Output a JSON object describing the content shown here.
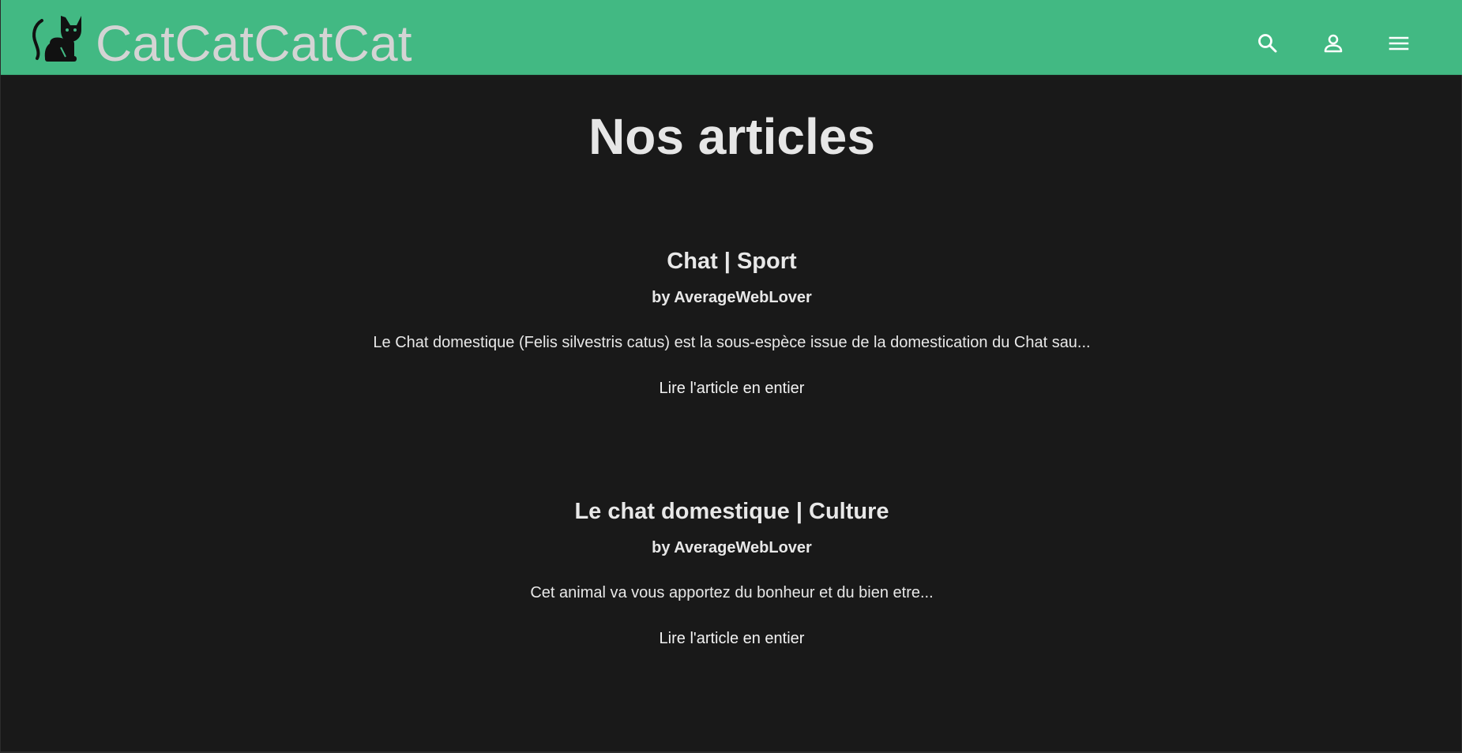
{
  "header": {
    "brand": "CatCatCatCat",
    "logo_icon": "cat-icon",
    "actions": [
      {
        "icon": "search-icon"
      },
      {
        "icon": "account-icon"
      },
      {
        "icon": "menu-icon"
      }
    ]
  },
  "main": {
    "heading": "Nos articles",
    "articles": [
      {
        "title": "Chat | Sport",
        "author": "by AverageWebLover",
        "excerpt": "Le Chat domestique (Felis silvestris catus) est la sous-espèce issue de la domestication du Chat sau...",
        "link_label": "Lire l'article en entier"
      },
      {
        "title": "Le chat domestique | Culture",
        "author": "by AverageWebLover",
        "excerpt": "Cet animal va vous apportez du bonheur et du bien etre...",
        "link_label": "Lire l'article en entier"
      }
    ]
  },
  "colors": {
    "header_bg": "#42b983",
    "page_bg": "#191919",
    "text": "#e8e8e8",
    "brand_text": "#d4d4d4"
  }
}
